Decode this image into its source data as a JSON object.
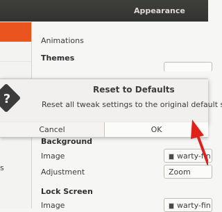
{
  "window": {
    "title": "Appearance"
  },
  "content": {
    "animations_label": "Animations",
    "themes_header": "Themes",
    "background_header": "Background",
    "background_image_label": "Image",
    "background_image_value": "warty-fin",
    "background_adjustment_label": "Adjustment",
    "background_adjustment_value": "Zoom",
    "lock_header": "Lock Screen",
    "lock_image_label": "Image",
    "lock_image_value": "warty-fin"
  },
  "sidebar": {
    "partial_text": "s"
  },
  "dialog": {
    "title": "Reset to Defaults",
    "message": "Reset all tweak settings to the original default sta",
    "icon": "question-icon",
    "cancel_label": "Cancel",
    "ok_label": "OK"
  },
  "colors": {
    "accent": "#e9541f",
    "annotation_arrow": "#e0201b"
  }
}
